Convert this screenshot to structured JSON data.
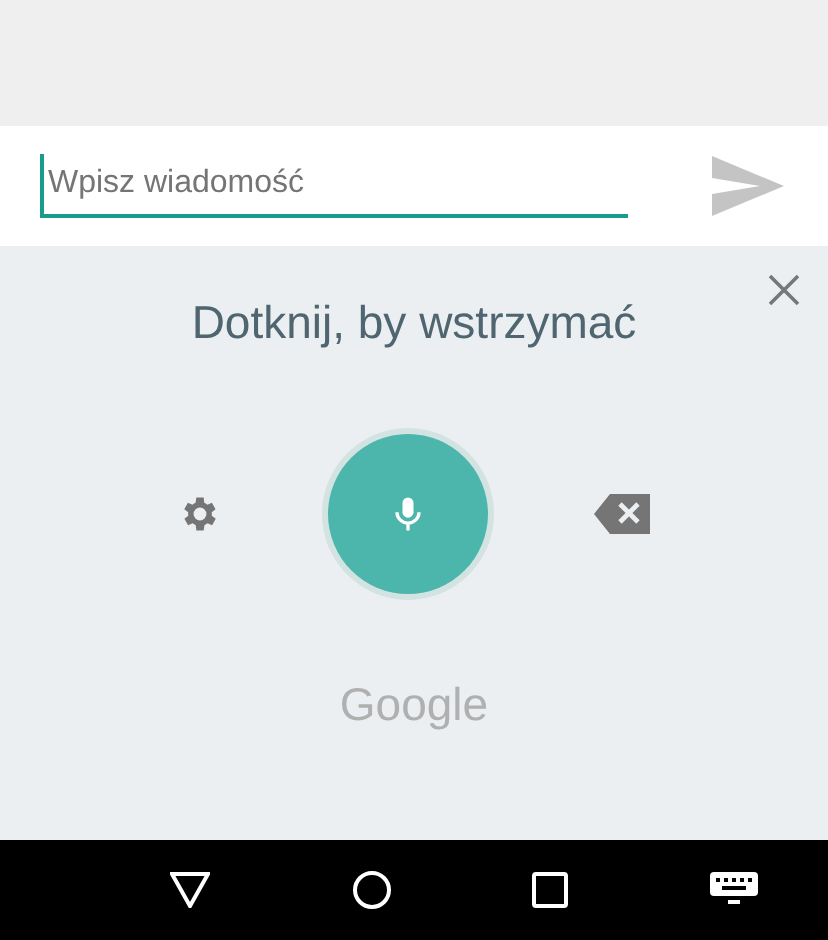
{
  "compose": {
    "placeholder": "Wpisz wiadomość",
    "focused": true
  },
  "voice_panel": {
    "prompt": "Dotknij, by wstrzymać",
    "brand": "Google"
  }
}
